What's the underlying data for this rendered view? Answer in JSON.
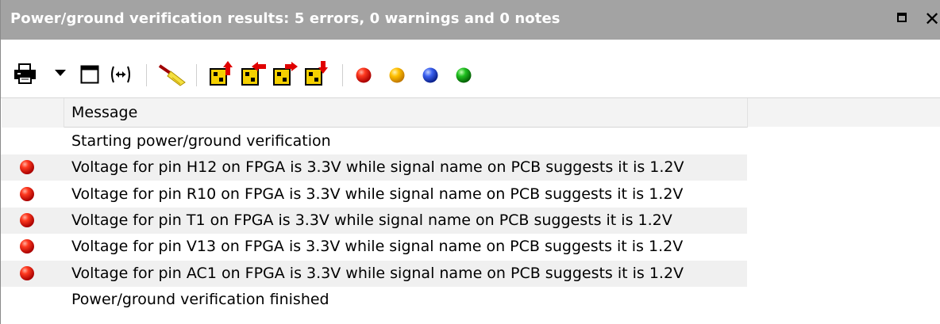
{
  "panel": {
    "title": "Power/ground verification results: 5 errors, 0 warnings and 0 notes",
    "maximize_icon": "maximize-icon",
    "close_glyph": "✕",
    "title_bar_color": "#a3a3a3"
  },
  "toolbar": {
    "icons": [
      "print-icon",
      "dropdown-arrow-icon",
      "window-icon",
      "fit-width-icon",
      "clear-filter-icon",
      "goto-first-icon",
      "goto-previous-icon",
      "goto-next-icon",
      "goto-last-icon",
      "error-filter-icon",
      "warning-filter-icon",
      "note-filter-icon",
      "info-filter-icon"
    ],
    "filter_colors": {
      "error": "#e01414",
      "warning": "#f0a800",
      "note": "#2050e0",
      "info": "#18a818"
    }
  },
  "table": {
    "column_header": "Message",
    "rows": [
      {
        "severity": "",
        "message": "Starting power/ground verification"
      },
      {
        "severity": "error",
        "message": "Voltage for pin H12 on FPGA is 3.3V while signal name on PCB suggests it is 1.2V"
      },
      {
        "severity": "error",
        "message": "Voltage for pin R10 on FPGA is 3.3V while signal name on PCB suggests it is 1.2V"
      },
      {
        "severity": "error",
        "message": "Voltage for pin T1 on FPGA is 3.3V while signal name on PCB suggests it is 1.2V"
      },
      {
        "severity": "error",
        "message": "Voltage for pin V13 on FPGA is 3.3V while signal name on PCB suggests it is 1.2V"
      },
      {
        "severity": "error",
        "message": "Voltage for pin AC1 on FPGA is 3.3V while signal name on PCB suggests it is 1.2V"
      },
      {
        "severity": "",
        "message": "Power/ground verification finished"
      }
    ]
  }
}
